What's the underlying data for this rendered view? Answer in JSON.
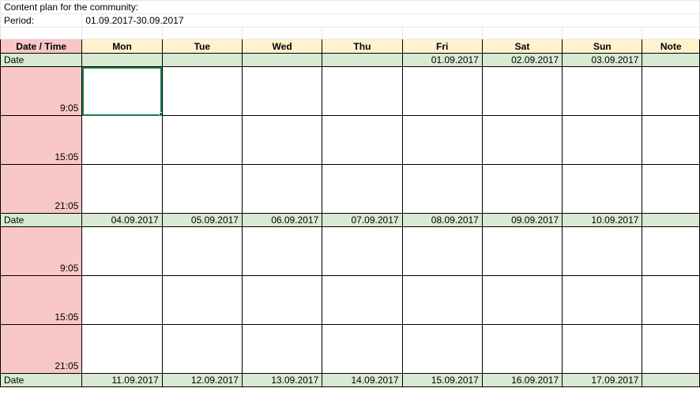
{
  "meta": {
    "title": "Content plan for the community:",
    "period_label": "Period:",
    "period_value": "01.09.2017-30.09.2017"
  },
  "header": {
    "first": "Date / Time",
    "days": [
      "Mon",
      "Tue",
      "Wed",
      "Thu",
      "Fri",
      "Sat",
      "Sun"
    ],
    "note": "Note"
  },
  "dateLabel": "Date",
  "times": [
    "9:05",
    "15:05",
    "21:05"
  ],
  "weeks": [
    {
      "dates": {
        "Mon": "",
        "Tue": "",
        "Wed": "",
        "Thu": "",
        "Fri": "01.09.2017",
        "Sat": "02.09.2017",
        "Sun": "03.09.2017"
      }
    },
    {
      "dates": {
        "Mon": "04.09.2017",
        "Tue": "05.09.2017",
        "Wed": "06.09.2017",
        "Thu": "07.09.2017",
        "Fri": "08.09.2017",
        "Sat": "09.09.2017",
        "Sun": "10.09.2017"
      }
    },
    {
      "dates": {
        "Mon": "11.09.2017",
        "Tue": "12.09.2017",
        "Wed": "13.09.2017",
        "Thu": "14.09.2017",
        "Fri": "15.09.2017",
        "Sat": "16.09.2017",
        "Sun": "17.09.2017"
      }
    }
  ]
}
